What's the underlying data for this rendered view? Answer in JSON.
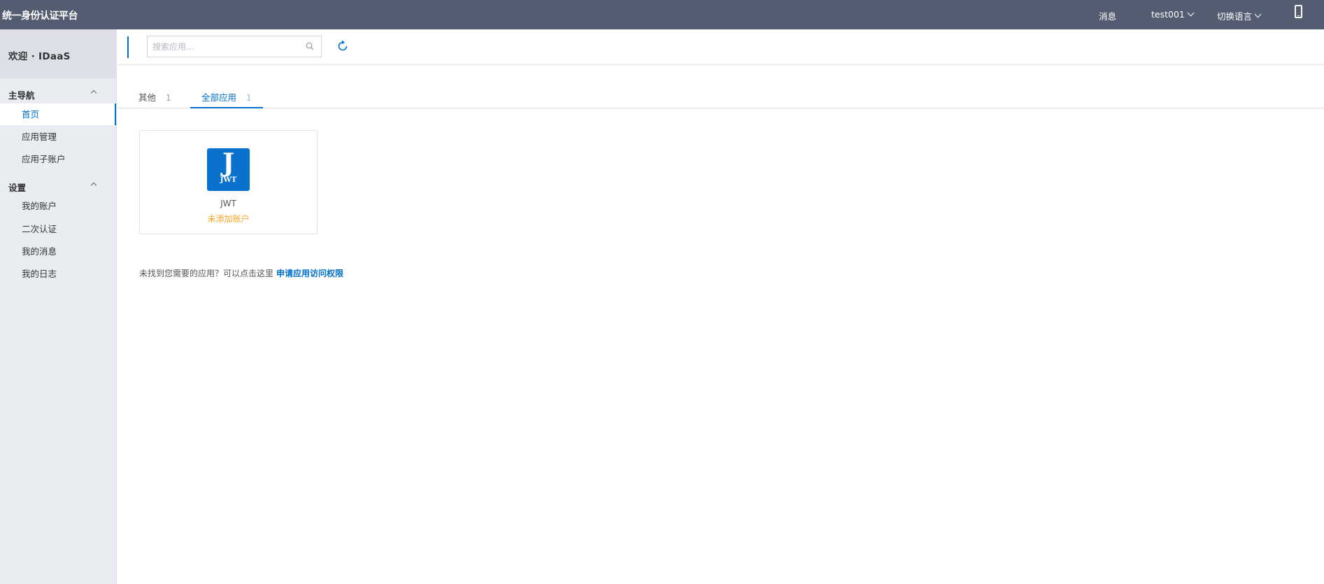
{
  "topbar": {
    "brand": "统一身份认证平台",
    "messages": "消息",
    "user": "test001",
    "language": "切换语言"
  },
  "sidebar": {
    "welcome": "欢迎 · IDaaS",
    "groups": [
      {
        "label": "主导航",
        "items": [
          "首页",
          "应用管理",
          "应用子账户"
        ]
      },
      {
        "label": "设置",
        "items": [
          "我的账户",
          "二次认证",
          "我的消息",
          "我的日志"
        ]
      }
    ],
    "active_item": "首页"
  },
  "toolbar": {
    "search_placeholder": "搜索应用..."
  },
  "tabs": [
    {
      "label": "其他",
      "count": "1"
    },
    {
      "label": "全部应用",
      "count": "1"
    }
  ],
  "active_tab": "全部应用",
  "apps": [
    {
      "logo_big": "J",
      "logo_small": "JWT",
      "name": "JWT",
      "status": "未添加账户"
    }
  ],
  "hint": {
    "text": "未找到您需要的应用？可以点击这里",
    "link": "申请应用访问权限"
  },
  "colors": {
    "topbar": "#535c70",
    "accent": "#0070cc",
    "warning": "#f5a623",
    "sidebar": "#e9ecf1"
  },
  "icons": [
    "chevron-down-icon",
    "phone-icon",
    "chevron-up-icon",
    "search-icon",
    "refresh-icon"
  ]
}
